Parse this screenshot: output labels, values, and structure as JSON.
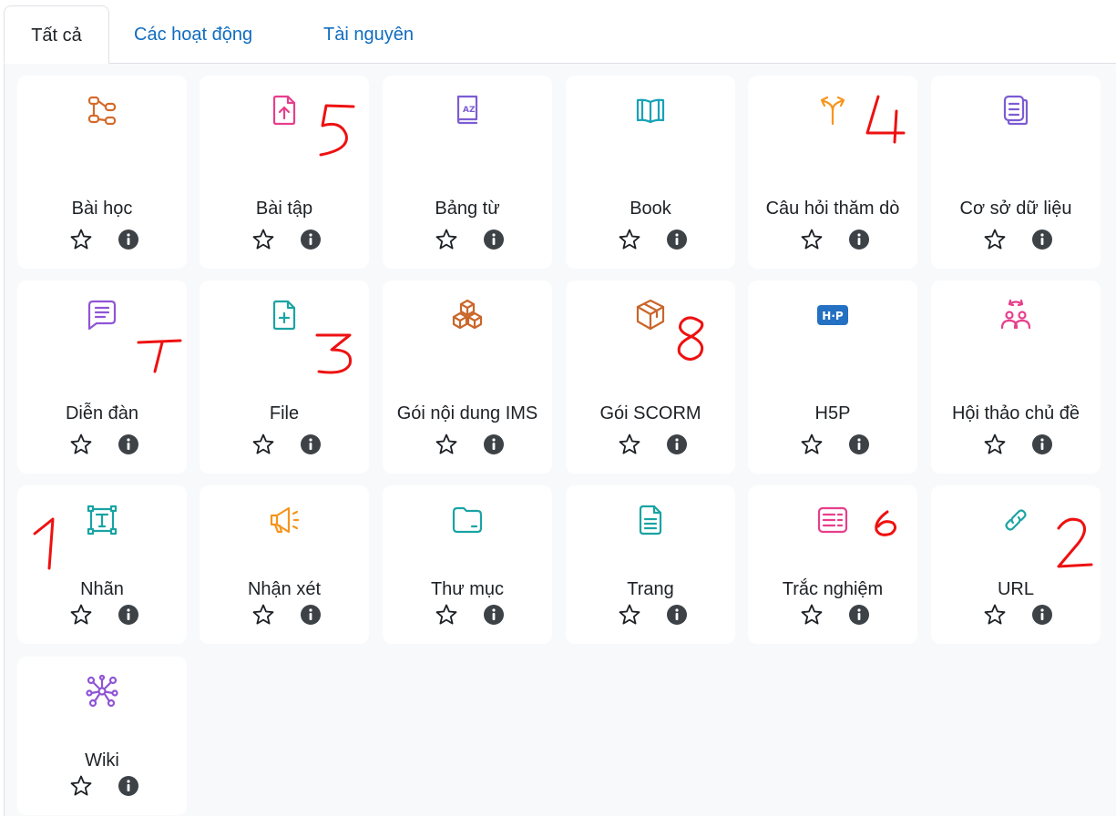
{
  "tabs": [
    {
      "label": "Tất cả",
      "active": true
    },
    {
      "label": "Các hoạt động",
      "active": false
    },
    {
      "label": "Tài nguyên",
      "active": false
    }
  ],
  "modules": [
    {
      "name": "Bài học",
      "icon": "lesson-icon",
      "color": "#d46a2a"
    },
    {
      "name": "Bài tập",
      "icon": "assignment-icon",
      "color": "#e83e8c"
    },
    {
      "name": "Bảng từ",
      "icon": "glossary-icon",
      "color": "#7c5cd4"
    },
    {
      "name": "Book",
      "icon": "book-icon",
      "color": "#17a2b8"
    },
    {
      "name": "Câu hỏi thăm dò",
      "icon": "choice-icon",
      "color": "#f7941d"
    },
    {
      "name": "Cơ sở dữ liệu",
      "icon": "database-icon",
      "color": "#7c5cd4"
    },
    {
      "name": "Diễn đàn",
      "icon": "forum-icon",
      "color": "#8f54d6"
    },
    {
      "name": "File",
      "icon": "file-icon",
      "color": "#1aa3a3"
    },
    {
      "name": "Gói nội dung IMS",
      "icon": "ims-package-icon",
      "color": "#c9662a"
    },
    {
      "name": "Gói SCORM",
      "icon": "scorm-package-icon",
      "color": "#c9662a"
    },
    {
      "name": "H5P",
      "icon": "h5p-icon",
      "color": "#2470c2"
    },
    {
      "name": "Hội thảo chủ đề",
      "icon": "workshop-icon",
      "color": "#e83e8c"
    },
    {
      "name": "Nhãn",
      "icon": "label-icon",
      "color": "#1aa3a3"
    },
    {
      "name": "Nhận xét",
      "icon": "feedback-icon",
      "color": "#f7941d"
    },
    {
      "name": "Thư mục",
      "icon": "folder-icon",
      "color": "#1aa3a3"
    },
    {
      "name": "Trang",
      "icon": "page-icon",
      "color": "#1aa3a3"
    },
    {
      "name": "Trắc nghiệm",
      "icon": "quiz-icon",
      "color": "#e83e8c"
    },
    {
      "name": "URL",
      "icon": "url-link-icon",
      "color": "#1aa3a3"
    },
    {
      "name": "Wiki",
      "icon": "wiki-icon",
      "color": "#8f54d6"
    }
  ],
  "annotations": [
    "5",
    "4",
    "7",
    "3",
    "8",
    "1",
    "6",
    "2"
  ],
  "colors": {
    "link": "#0f6cbf",
    "annotation": "#ee1111",
    "panel_bg": "#f8f9fa",
    "info_icon": "#3d4247"
  }
}
